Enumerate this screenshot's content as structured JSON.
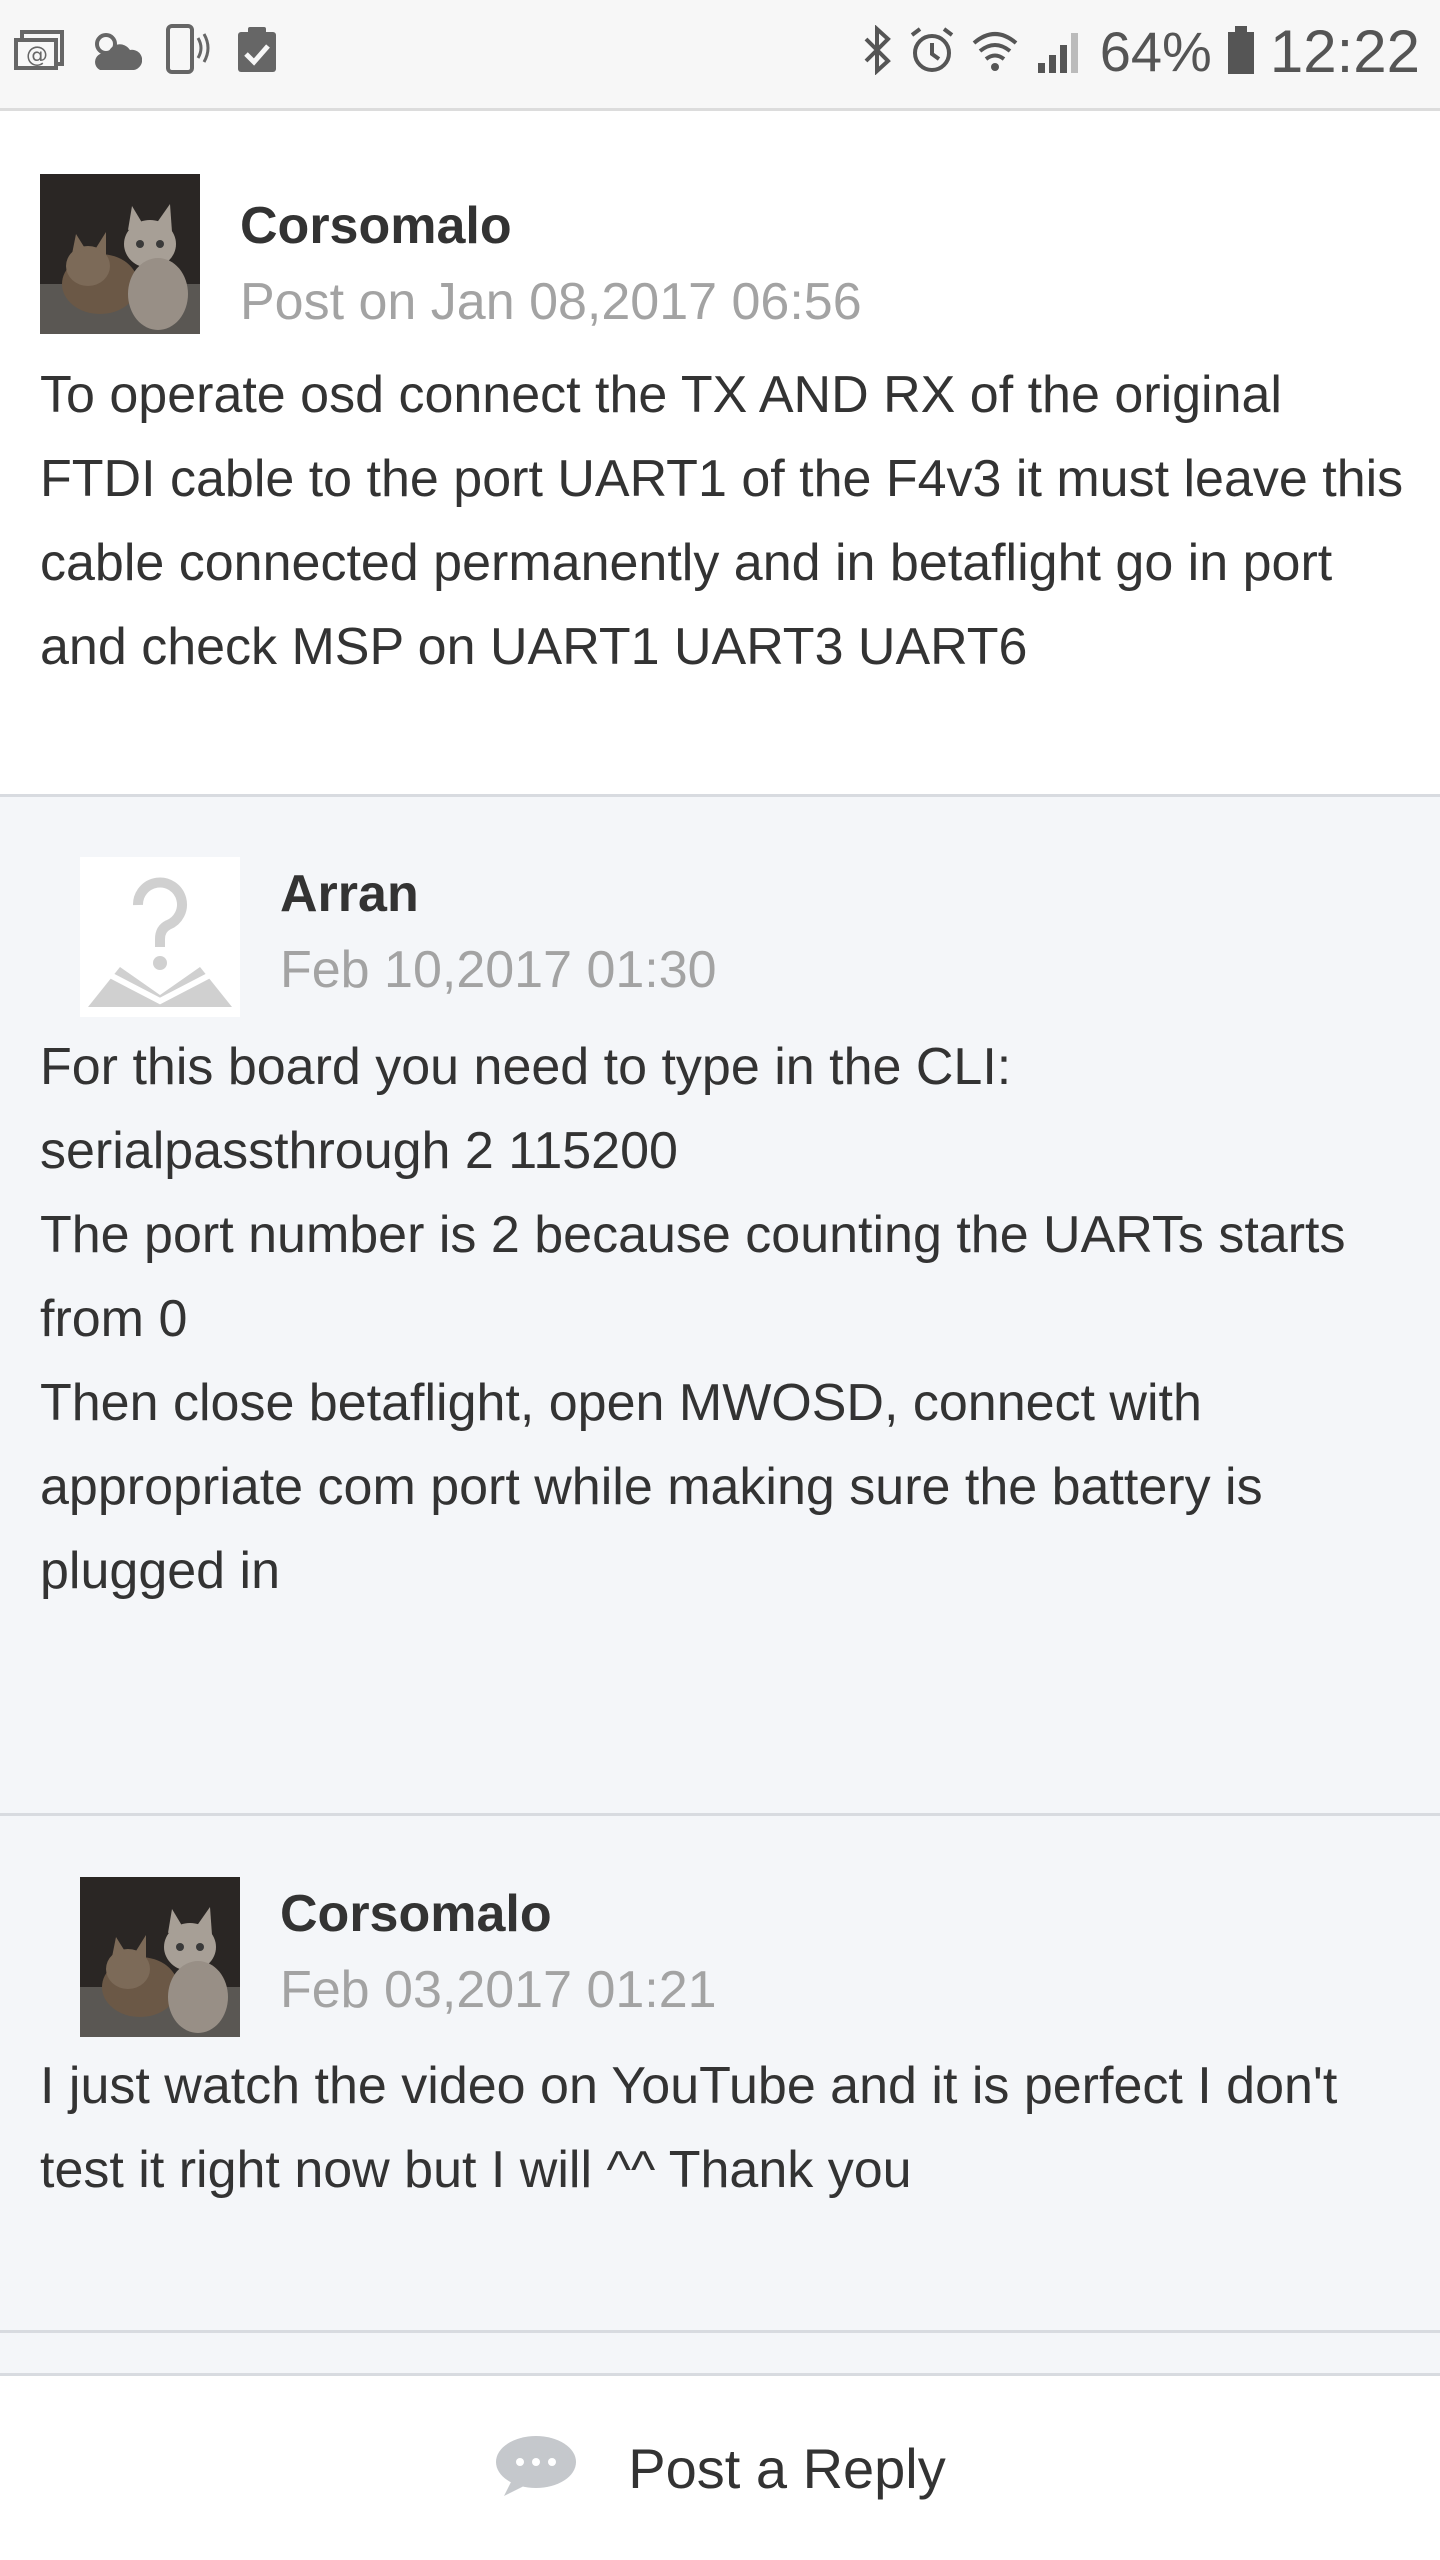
{
  "status_bar": {
    "battery_percent": "64%",
    "time": "12:22",
    "left_icons": [
      "mail-notification-icon",
      "weather-icon",
      "phone-vibrate-icon",
      "clipboard-check-icon"
    ],
    "right_icons": [
      "bluetooth-icon",
      "alarm-icon",
      "wifi-icon",
      "signal-icon",
      "battery-icon"
    ]
  },
  "posts": [
    {
      "author": "Corsomalo",
      "date": "Post on Jan 08,2017 06:56",
      "avatar": "cat-photo",
      "body": "To operate osd connect the TX AND RX of the original FTDI cable to the port UART1 of the F4v3 it must leave this cable connected permanently and in betaflight go in port and check MSP on UART1 UART3 UART6"
    },
    {
      "author": "Arran",
      "date": "Feb 10,2017 01:30",
      "avatar": "placeholder",
      "body_lines": [
        "For this board you need to type in the CLI:",
        "serialpassthrough 2 115200",
        "The port number is 2 because counting the UARTs starts from 0",
        "Then close betaflight, open MWOSD, connect with appropriate com port while making sure the battery is plugged in"
      ]
    },
    {
      "author": "Corsomalo",
      "date": "Feb 03,2017 01:21",
      "avatar": "cat-photo",
      "body": "I just watch the video on YouTube and it is perfect I don't test it right now but I will ^^ Thank you"
    }
  ],
  "reply_bar": {
    "label": "Post a Reply",
    "icon": "chat-bubble-icon"
  },
  "colors": {
    "main_bg": "#ffffff",
    "reply_bg": "#f4f6f9",
    "date_text": "#a3a3a3",
    "divider": "#d8dbe0"
  }
}
